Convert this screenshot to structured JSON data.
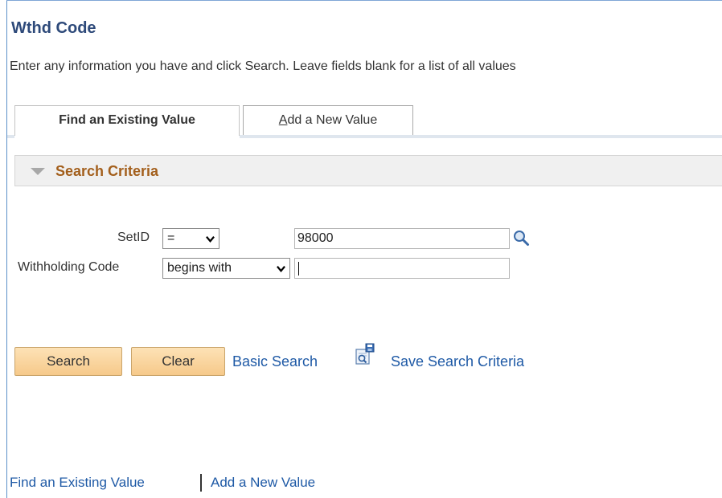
{
  "page": {
    "title": "Wthd Code",
    "instructions": "Enter any information you have and click Search. Leave fields blank for a list of all values"
  },
  "tabs": [
    {
      "label": "Find an Existing Value",
      "active": true
    },
    {
      "label_underlined": "A",
      "label_rest": "dd a New Value",
      "active": false
    }
  ],
  "criteria": {
    "title": "Search Criteria",
    "icon": "collapse-triangle-icon"
  },
  "fields": {
    "setid": {
      "label": "SetID",
      "operator": "=",
      "value": "98000",
      "lookup_icon": "magnifier-icon"
    },
    "withholding_code": {
      "label": "Withholding Code",
      "operator": "begins with",
      "value": ""
    }
  },
  "actions": {
    "search": "Search",
    "clear": "Clear",
    "basic_search": "Basic Search",
    "save_search": "Save Search Criteria"
  },
  "footer": {
    "find": "Find an Existing Value",
    "add": "Add a New Value"
  },
  "colors": {
    "title": "#2e4a7a",
    "criteria_title": "#a35f1c",
    "link": "#1f5aa6",
    "button": "#f6c98a"
  }
}
